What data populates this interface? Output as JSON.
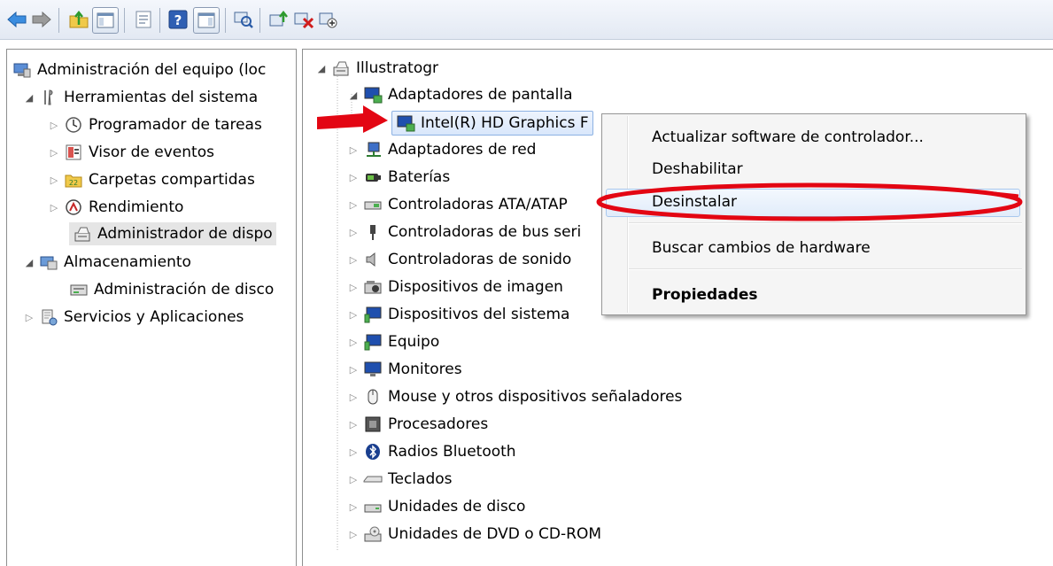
{
  "toolbar": {
    "buttons": [
      "back-arrow-icon",
      "forward-arrow-icon",
      "up-folder-icon",
      "show-hide-tree-icon",
      "properties-icon",
      "help-icon",
      "action-pane-icon",
      "scan-hardware-icon",
      "update-driver-icon",
      "uninstall-icon",
      "enable-device-icon"
    ]
  },
  "left_tree": {
    "root": "Administración del equipo (loc",
    "herramientas": "Herramientas del sistema",
    "programador": "Programador de tareas",
    "visor": "Visor de eventos",
    "carpetas": "Carpetas compartidas",
    "rendimiento": "Rendimiento",
    "administrador": "Administrador de dispo",
    "almacenamiento": "Almacenamiento",
    "admin_disco": "Administración de disco",
    "servicios": "Servicios y Aplicaciones"
  },
  "right_tree": {
    "computer": "Illustratogr",
    "adaptadores_pantalla": "Adaptadores de pantalla",
    "intel": "Intel(R) HD Graphics F",
    "adaptadores_red": "Adaptadores de red",
    "baterias": "Baterías",
    "ata": "Controladoras ATA/ATAP",
    "bus": "Controladoras de bus seri",
    "sonido": "Controladoras de sonido",
    "imagen": "Dispositivos de imagen",
    "sistema": "Dispositivos del sistema",
    "equipo": "Equipo",
    "monitores": "Monitores",
    "mouse": "Mouse y otros dispositivos señaladores",
    "procesadores": "Procesadores",
    "bluetooth": "Radios Bluetooth",
    "teclados": "Teclados",
    "disco": "Unidades de disco",
    "dvd": "Unidades de DVD o CD-ROM"
  },
  "context_menu": {
    "actualizar": "Actualizar software de controlador...",
    "deshabilitar": "Deshabilitar",
    "desinstalar": "Desinstalar",
    "buscar": "Buscar cambios de hardware",
    "propiedades": "Propiedades"
  },
  "colors": {
    "annotation": "#e30613",
    "selection_border": "#8db2e3",
    "pane_border": "#8e8f8f"
  }
}
